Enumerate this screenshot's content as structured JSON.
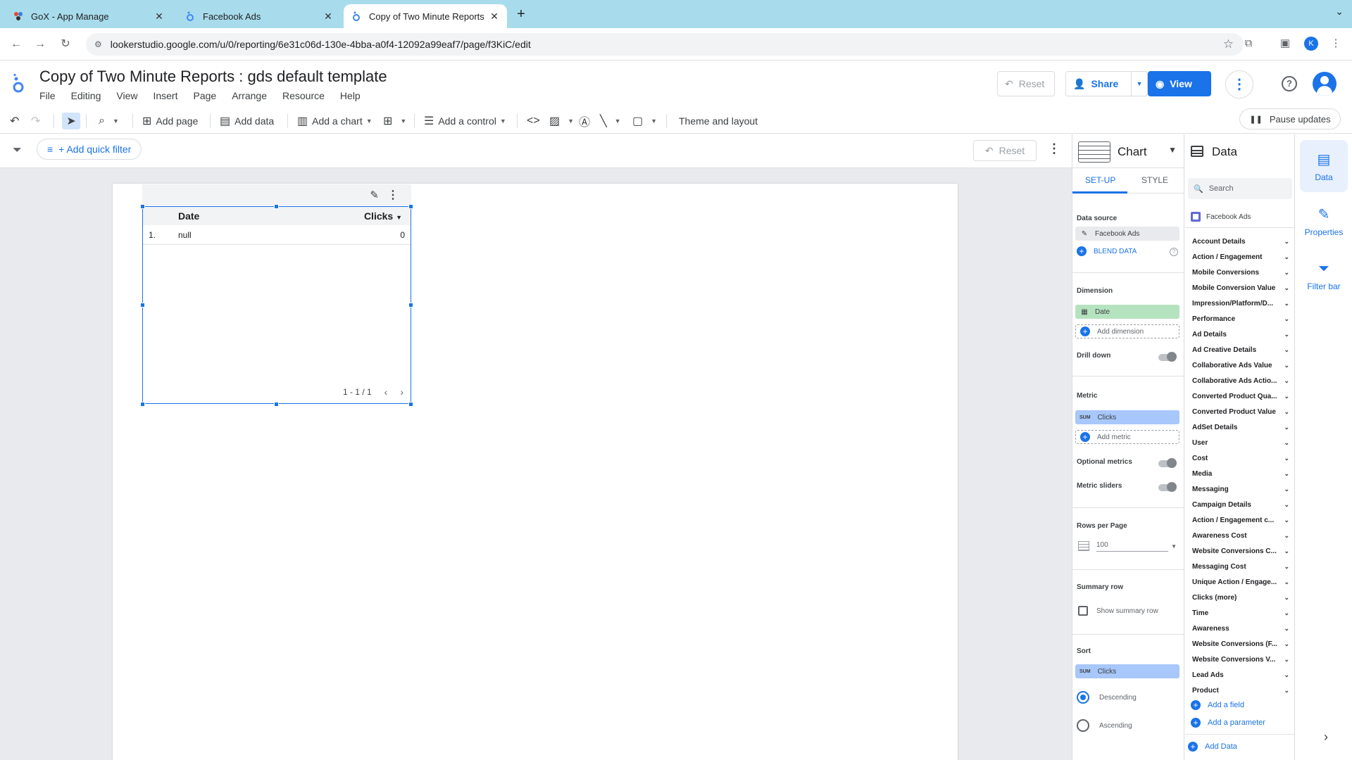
{
  "browser": {
    "tabs": [
      {
        "title": "GoX - App Manage",
        "active": false
      },
      {
        "title": "Facebook Ads",
        "active": false
      },
      {
        "title": "Copy of Two Minute Reports",
        "active": true
      }
    ],
    "new_tab": "+",
    "url": "lookerstudio.google.com/u/0/reporting/6e31c06d-130e-4bba-a0f4-12092a99eaf7/page/f3KiC/edit",
    "profile_initial": "K"
  },
  "header": {
    "title": "Copy of Two Minute Reports : gds default template",
    "menu": [
      "File",
      "Editing",
      "View",
      "Insert",
      "Page",
      "Arrange",
      "Resource",
      "Help"
    ],
    "reset_label": "Reset",
    "share_label": "Share",
    "view_label": "View"
  },
  "toolbar": {
    "add_page": "Add page",
    "add_data": "Add data",
    "add_chart": "Add a chart",
    "add_control": "Add a control",
    "theme_layout": "Theme and layout",
    "pause_updates": "Pause updates"
  },
  "filterbar": {
    "quick_filter": "+ Add quick filter",
    "reset_label": "Reset"
  },
  "table_chart": {
    "columns": [
      "Date",
      "Clicks"
    ],
    "rows": [
      {
        "num": "1.",
        "date": "null",
        "clicks": "0"
      }
    ],
    "pagination": "1 - 1 / 1"
  },
  "chart_panel": {
    "title": "Chart",
    "tabs": [
      "SET-UP",
      "STYLE"
    ],
    "data_source_label": "Data source",
    "data_source": "Facebook Ads",
    "blend_data": "BLEND DATA",
    "dimension_label": "Dimension",
    "dimension": "Date",
    "add_dimension": "Add dimension",
    "drill_down": "Drill down",
    "metric_label": "Metric",
    "metric_agg": "SUM",
    "metric": "Clicks",
    "add_metric": "Add metric",
    "optional_metrics": "Optional metrics",
    "metric_sliders": "Metric sliders",
    "rows_per_page_label": "Rows per Page",
    "rows_per_page": "100",
    "summary_row_label": "Summary row",
    "show_summary_row": "Show summary row",
    "sort_label": "Sort",
    "sort_agg": "SUM",
    "sort_field": "Clicks",
    "descending": "Descending",
    "ascending": "Ascending"
  },
  "data_panel": {
    "title": "Data",
    "search_placeholder": "Search",
    "source": "Facebook Ads",
    "groups": [
      "Account Details",
      "Action / Engagement",
      "Mobile Conversions",
      "Mobile Conversion Value",
      "Impression/Platform/D...",
      "Performance",
      "Ad Details",
      "Ad Creative Details",
      "Collaborative Ads Value",
      "Collaborative Ads Actio...",
      "Converted Product Qua...",
      "Converted Product Value",
      "AdSet Details",
      "User",
      "Cost",
      "Media",
      "Messaging",
      "Campaign Details",
      "Action / Engagement c...",
      "Awareness Cost",
      "Website Conversions C...",
      "Messaging Cost",
      "Unique Action / Engage...",
      "Clicks (more)",
      "Time",
      "Awareness",
      "Website Conversions (F...",
      "Website Conversions V...",
      "Lead Ads",
      "Product"
    ],
    "add_field": "Add a field",
    "add_parameter": "Add a parameter",
    "add_data": "Add Data"
  },
  "rail": {
    "items": [
      "Data",
      "Properties",
      "Filter bar"
    ]
  },
  "colors": {
    "accent": "#1a73e8",
    "tabbar": "#a8dced",
    "dimension_pill": "#b6e3bf",
    "metric_pill": "#a8c7fa"
  }
}
